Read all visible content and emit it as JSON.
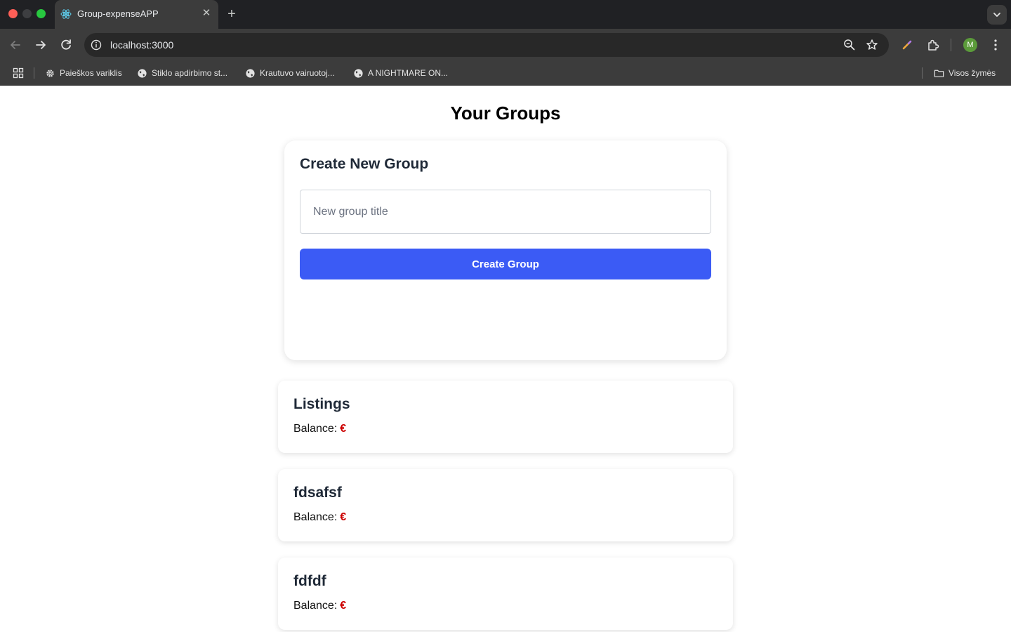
{
  "browser": {
    "tab_title": "Group-expenseAPP",
    "url": "localhost:3000",
    "profile_initial": "M",
    "bookmarks": [
      {
        "label": "Paieškos variklis",
        "icon": "gear-icon"
      },
      {
        "label": "Stiklo apdirbimo st...",
        "icon": "globe-icon"
      },
      {
        "label": "Krautuvo vairuotoj...",
        "icon": "globe-icon"
      },
      {
        "label": "A NIGHTMARE ON...",
        "icon": "globe-icon"
      }
    ],
    "all_bookmarks_label": "Visos žymės"
  },
  "page": {
    "title": "Your Groups",
    "create": {
      "heading": "Create New Group",
      "input_placeholder": "New group title",
      "button_label": "Create Group"
    },
    "balance_label": "Balance:",
    "currency_symbol": "€",
    "groups": [
      {
        "title": "Listings"
      },
      {
        "title": "fdsafsf"
      },
      {
        "title": "fdfdf"
      }
    ]
  },
  "colors": {
    "primary_button": "#3b5bf5",
    "currency": "#cc0000",
    "chrome_dark": "#202124",
    "chrome_toolbar": "#3c3c3c"
  }
}
